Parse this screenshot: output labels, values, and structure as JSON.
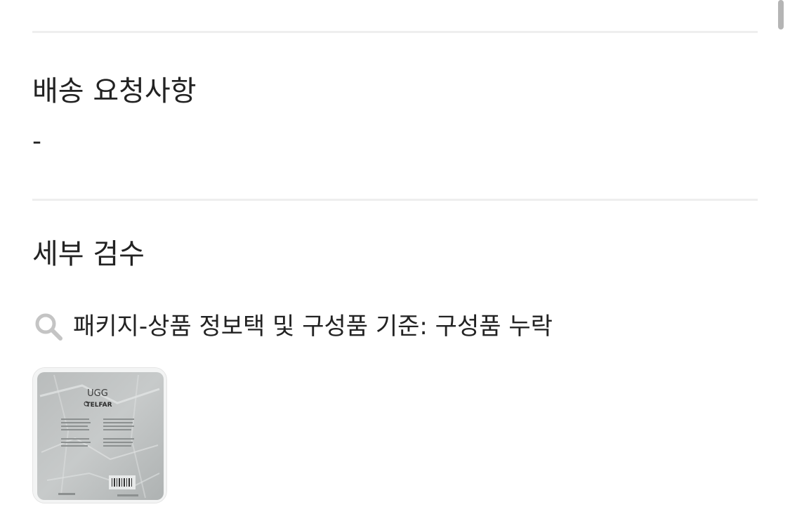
{
  "delivery_request": {
    "title": "배송 요청사항",
    "value": "-"
  },
  "inspection": {
    "title": "세부 검수",
    "finding_text": "패키지-상품 정보택 및 구성품 기준: 구성품 누락",
    "finding_icon": "search-icon",
    "photo": {
      "brand_line1": "UGG",
      "brand_line2": "TELFAR"
    }
  },
  "colors": {
    "text": "#222222",
    "divider": "#eeeeee",
    "icon": "#c4c4c4",
    "scrollbar": "#b5b5b5"
  }
}
